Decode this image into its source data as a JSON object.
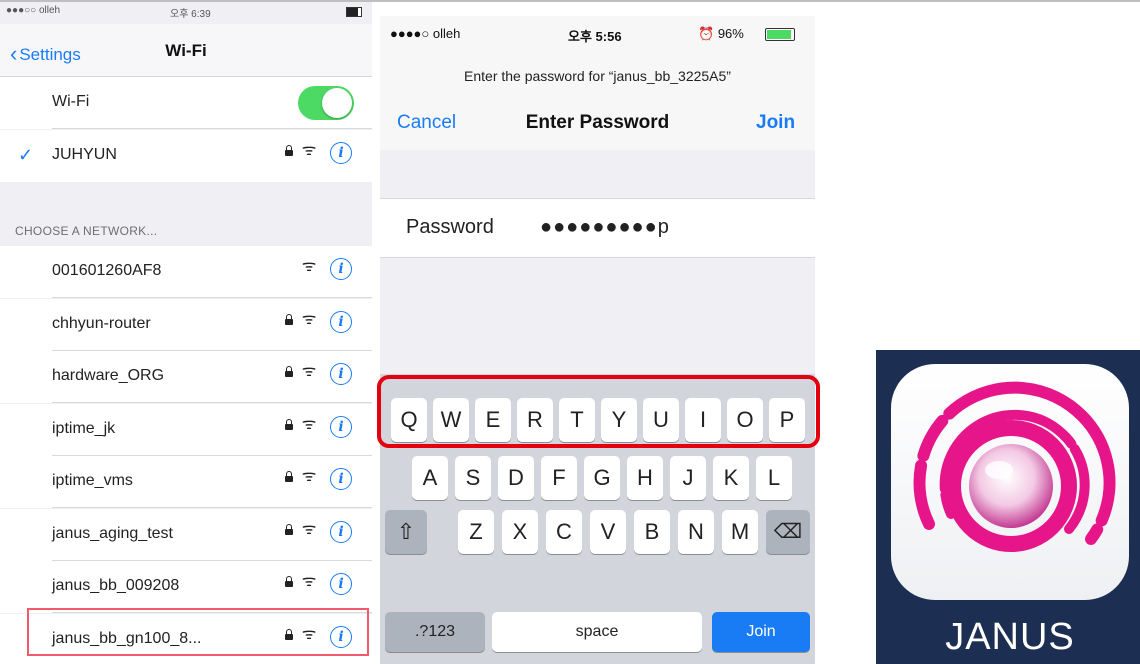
{
  "wifi_panel": {
    "status": {
      "carrier": "●●●○○ olleh",
      "time": "오후 6:39"
    },
    "nav": {
      "back_label": "Settings",
      "title": "Wi-Fi"
    },
    "wifi_toggle": {
      "label": "Wi-Fi",
      "on": true
    },
    "connected": {
      "name": "JUHYUN",
      "locked": true
    },
    "section_header": "CHOOSE A NETWORK...",
    "networks": [
      {
        "name": "001601260AF8",
        "locked": false
      },
      {
        "name": "chhyun-router",
        "locked": true
      },
      {
        "name": "hardware_ORG",
        "locked": true
      },
      {
        "name": "iptime_jk",
        "locked": true
      },
      {
        "name": "iptime_vms",
        "locked": true
      },
      {
        "name": "janus_aging_test",
        "locked": true
      },
      {
        "name": "janus_bb_009208",
        "locked": true
      },
      {
        "name": "janus_bb_gn100_8...",
        "locked": true,
        "highlighted": true
      }
    ],
    "info_glyph": "i"
  },
  "password_panel": {
    "status": {
      "carrier": "●●●●○ olleh",
      "time": "오후 5:56",
      "battery": "96%"
    },
    "prompt": "Enter the password for “janus_bb_3225A5”",
    "cancel_label": "Cancel",
    "title": "Enter Password",
    "join_label": "Join",
    "password_label": "Password",
    "password_value": "●●●●●●●●●p",
    "keyboard": {
      "row1": [
        "Q",
        "W",
        "E",
        "R",
        "T",
        "Y",
        "U",
        "I",
        "O",
        "P"
      ],
      "row2": [
        "A",
        "S",
        "D",
        "F",
        "G",
        "H",
        "J",
        "K",
        "L"
      ],
      "row3": [
        "Z",
        "X",
        "C",
        "V",
        "B",
        "N",
        "M"
      ],
      "shift_glyph": "⇧",
      "delete_glyph": "⌫",
      "numbers_label": ".?123",
      "space_label": "space",
      "return_label": "Join"
    }
  },
  "app_icon": {
    "label": "JANUS"
  },
  "colors": {
    "accent": "#1a7cf5",
    "toggle_on": "#4cd964",
    "highlight_red": "#e3000f",
    "janus_pink": "#e6168a"
  }
}
